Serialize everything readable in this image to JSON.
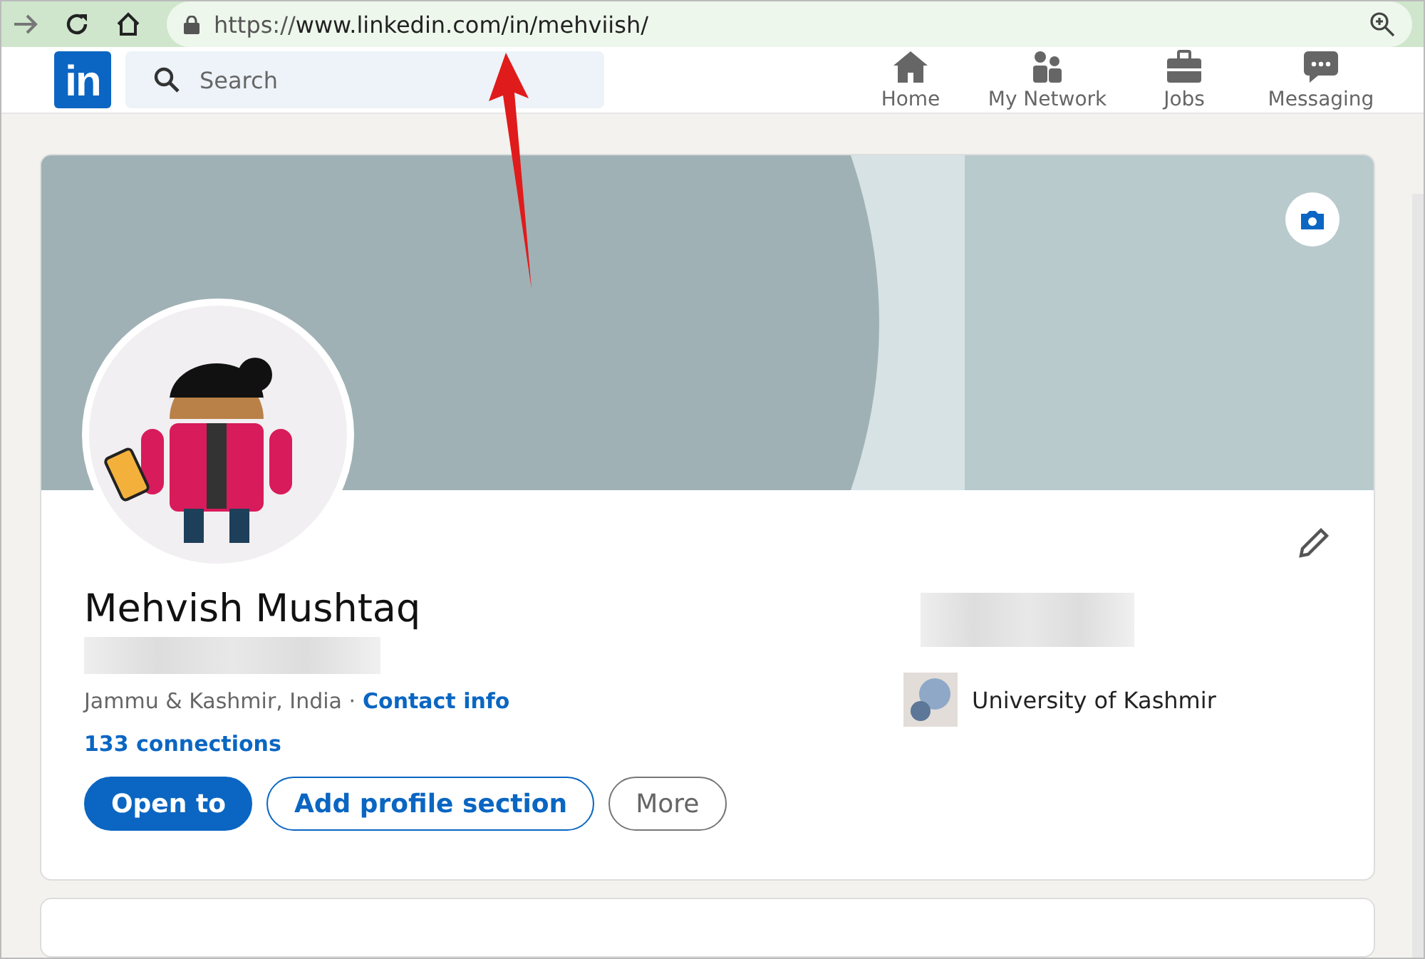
{
  "browser": {
    "url_scheme": "https://",
    "url_rest": "www.linkedin.com/in/mehviish/"
  },
  "header": {
    "logo": "in",
    "search": {
      "placeholder": "Search"
    },
    "nav": [
      {
        "kind": "home",
        "label": "Home"
      },
      {
        "kind": "network",
        "label": "My Network"
      },
      {
        "kind": "jobs",
        "label": "Jobs"
      },
      {
        "kind": "messaging",
        "label": "Messaging"
      }
    ]
  },
  "profile": {
    "name": "Mehvish Mushtaq",
    "location": "Jammu & Kashmir, India ·",
    "contact_link": "Contact info",
    "connections": "133 connections",
    "buttons": [
      {
        "kind": "primary",
        "label": "Open to"
      },
      {
        "kind": "outline",
        "label": "Add profile section"
      },
      {
        "kind": "secondary",
        "label": "More"
      }
    ],
    "education": "University of Kashmir"
  }
}
